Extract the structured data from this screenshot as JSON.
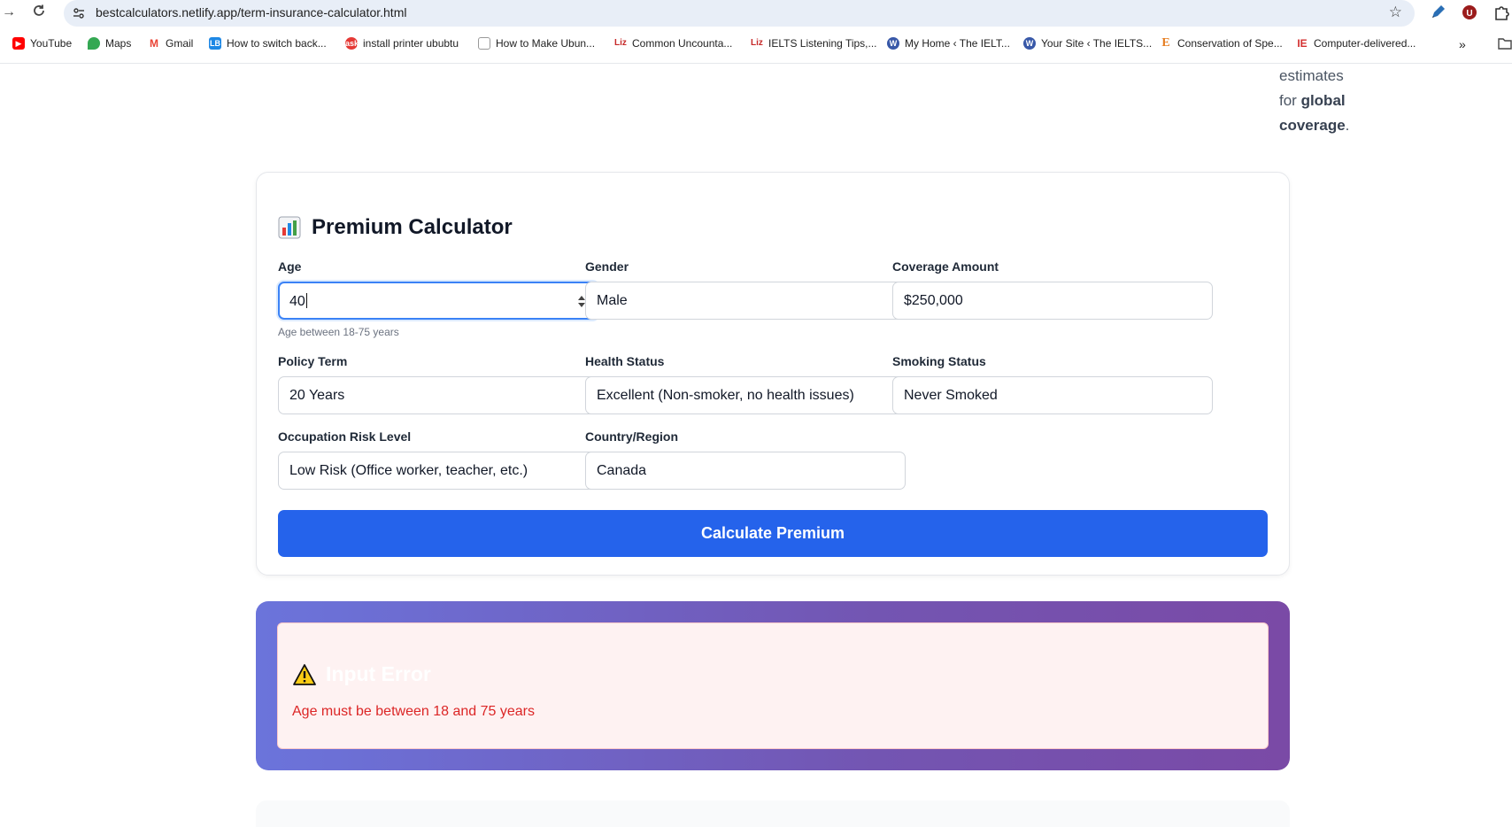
{
  "browser": {
    "url_host": "bestcalculators.netlify.app",
    "url_path": "/term-insurance-calculator.html",
    "bookmarks": [
      {
        "label": "YouTube",
        "icon": "youtube-icon"
      },
      {
        "label": "Maps",
        "icon": "maps-icon"
      },
      {
        "label": "Gmail",
        "icon": "gmail-icon"
      },
      {
        "label": "How to switch back...",
        "icon": "lb-icon"
      },
      {
        "label": "install printer ububtu",
        "icon": "ask-icon"
      },
      {
        "label": "How to Make Ubun...",
        "icon": "site-icon"
      },
      {
        "label": "Common Uncounta...",
        "icon": "liz-icon"
      },
      {
        "label": "IELTS Listening Tips,...",
        "icon": "liz-icon"
      },
      {
        "label": "My Home ‹ The IELT...",
        "icon": "wordpress-icon"
      },
      {
        "label": "Your Site ‹ The IELTS...",
        "icon": "wordpress-icon"
      },
      {
        "label": "Conservation of Spe...",
        "icon": "e-icon"
      },
      {
        "label": "Computer-delivered...",
        "icon": "ie-icon"
      }
    ],
    "more": "»"
  },
  "side_text": {
    "line1": "estimates",
    "line2_pre": "for ",
    "line2_bold": "global",
    "line3_bold": "coverage",
    "line3_post": "."
  },
  "calculator": {
    "title": "Premium Calculator",
    "fields": {
      "age": {
        "label": "Age",
        "value": "40",
        "hint": "Age between 18-75 years"
      },
      "gender": {
        "label": "Gender",
        "value": "Male"
      },
      "coverage": {
        "label": "Coverage Amount",
        "value": "$250,000"
      },
      "term": {
        "label": "Policy Term",
        "value": "20 Years"
      },
      "health": {
        "label": "Health Status",
        "value": "Excellent (Non-smoker, no health issues)"
      },
      "smoking": {
        "label": "Smoking Status",
        "value": "Never Smoked"
      },
      "occupation": {
        "label": "Occupation Risk Level",
        "value": "Low Risk (Office worker, teacher, etc.)"
      },
      "country": {
        "label": "Country/Region",
        "value": "Canada"
      }
    },
    "button_label": "Calculate Premium"
  },
  "error": {
    "title": "Input Error",
    "message": "Age must be between 18 and 75 years"
  },
  "colors": {
    "primary": "#2563eb",
    "error_text": "#dc2626",
    "gradient_start": "#6b74db",
    "gradient_end": "#7a4aa6"
  }
}
